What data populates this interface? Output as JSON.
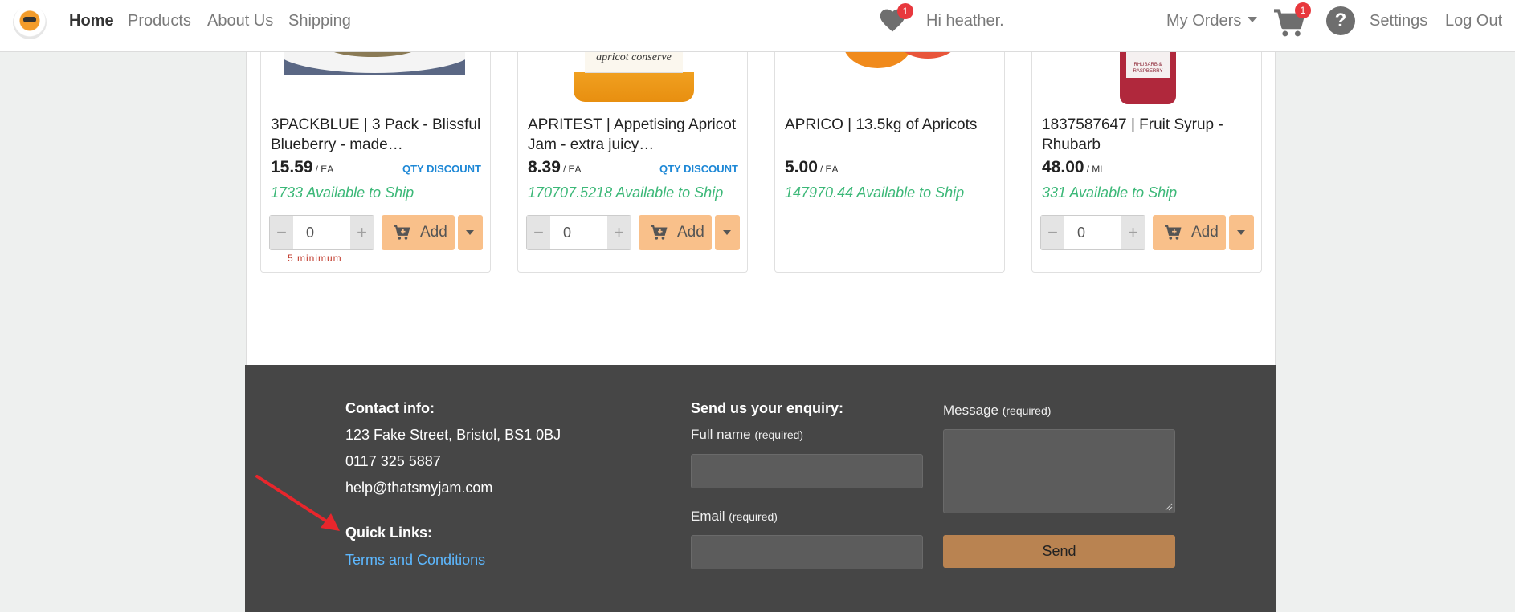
{
  "navbar": {
    "links": [
      "Home",
      "Products",
      "About Us",
      "Shipping"
    ],
    "wishlist_count": "1",
    "greeting": "Hi heather.",
    "orders_label": "My Orders",
    "cart_count": "1",
    "help_icon_glyph": "?",
    "settings_label": "Settings",
    "logout_label": "Log Out"
  },
  "products": [
    {
      "title": "3PACKBLUE | 3 Pack - Blissful Blueberry - made…",
      "price": "15.59",
      "unit": "/ EA",
      "qty_discount": "QTY DISCOUNT",
      "available": "1733 Available to Ship",
      "qty": "0",
      "add_label": "Add",
      "min_note": "5 minimum"
    },
    {
      "title": "APRITEST | Appetising Apricot Jam - extra juicy…",
      "price": "8.39",
      "unit": "/ EA",
      "qty_discount": "QTY DISCOUNT",
      "available": "170707.5218 Available to Ship",
      "qty": "0",
      "add_label": "Add"
    },
    {
      "title": "APRICO | 13.5kg of Apricots",
      "price": "5.00",
      "unit": "/ EA",
      "available": "147970.44 Available to Ship"
    },
    {
      "title": "1837587647 | Fruit Syrup - Rhubarb",
      "price": "48.00",
      "unit": "/ ML",
      "available": "331 Available to Ship",
      "qty": "0",
      "add_label": "Add"
    }
  ],
  "footer": {
    "contact_heading": "Contact info:",
    "address": "123 Fake Street, Bristol, BS1 0BJ",
    "phone": "0117 325 5887",
    "email": "help@thatsmyjam.com",
    "quicklinks_heading": "Quick Links:",
    "terms_link": "Terms and Conditions",
    "enquiry_heading": "Send us your enquiry:",
    "fullname_label": "Full name",
    "email_label": "Email",
    "message_label": "Message",
    "required_note": "(required)",
    "send_label": "Send"
  },
  "colors": {
    "accent_orange": "#f9c08a",
    "available_green": "#3cb878",
    "discount_blue": "#1e88d6",
    "badge_red": "#e8383d",
    "footer_bg": "#464646",
    "send_button": "#b98351",
    "annotation_arrow": "#e8262c"
  },
  "icons": [
    "logo-icon",
    "heart-icon",
    "cart-icon",
    "help-icon",
    "cart-add-icon",
    "chevron-down-icon",
    "annotation-arrow"
  ]
}
